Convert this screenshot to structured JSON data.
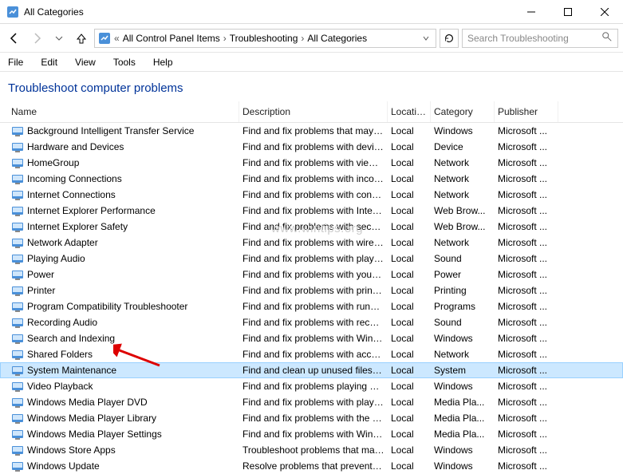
{
  "window": {
    "title": "All Categories"
  },
  "nav": {
    "breadcrumb": [
      "All Control Panel Items",
      "Troubleshooting",
      "All Categories"
    ],
    "search_placeholder": "Search Troubleshooting"
  },
  "menu": {
    "items": [
      "File",
      "Edit",
      "View",
      "Tools",
      "Help"
    ]
  },
  "heading": "Troubleshoot computer problems",
  "columns": {
    "name": "Name",
    "desc": "Description",
    "loc": "Location",
    "cat": "Category",
    "pub": "Publisher"
  },
  "rows": [
    {
      "name": "Background Intelligent Transfer Service",
      "desc": "Find and fix problems that may p...",
      "loc": "Local",
      "cat": "Windows",
      "pub": "Microsoft ..."
    },
    {
      "name": "Hardware and Devices",
      "desc": "Find and fix problems with device...",
      "loc": "Local",
      "cat": "Device",
      "pub": "Microsoft ..."
    },
    {
      "name": "HomeGroup",
      "desc": "Find and fix problems with viewin...",
      "loc": "Local",
      "cat": "Network",
      "pub": "Microsoft ..."
    },
    {
      "name": "Incoming Connections",
      "desc": "Find and fix problems with incom...",
      "loc": "Local",
      "cat": "Network",
      "pub": "Microsoft ..."
    },
    {
      "name": "Internet Connections",
      "desc": "Find and fix problems with conne...",
      "loc": "Local",
      "cat": "Network",
      "pub": "Microsoft ..."
    },
    {
      "name": "Internet Explorer Performance",
      "desc": "Find and fix problems with Intern...",
      "loc": "Local",
      "cat": "Web Brow...",
      "pub": "Microsoft ..."
    },
    {
      "name": "Internet Explorer Safety",
      "desc": "Find and fix problems with securi...",
      "loc": "Local",
      "cat": "Web Brow...",
      "pub": "Microsoft ..."
    },
    {
      "name": "Network Adapter",
      "desc": "Find and fix problems with wirele...",
      "loc": "Local",
      "cat": "Network",
      "pub": "Microsoft ..."
    },
    {
      "name": "Playing Audio",
      "desc": "Find and fix problems with playin...",
      "loc": "Local",
      "cat": "Sound",
      "pub": "Microsoft ..."
    },
    {
      "name": "Power",
      "desc": "Find and fix problems with your c...",
      "loc": "Local",
      "cat": "Power",
      "pub": "Microsoft ..."
    },
    {
      "name": "Printer",
      "desc": "Find and fix problems with printi...",
      "loc": "Local",
      "cat": "Printing",
      "pub": "Microsoft ..."
    },
    {
      "name": "Program Compatibility Troubleshooter",
      "desc": "Find and fix problems with runni...",
      "loc": "Local",
      "cat": "Programs",
      "pub": "Microsoft ..."
    },
    {
      "name": "Recording Audio",
      "desc": "Find and fix problems with record...",
      "loc": "Local",
      "cat": "Sound",
      "pub": "Microsoft ..."
    },
    {
      "name": "Search and Indexing",
      "desc": "Find and fix problems with Wind...",
      "loc": "Local",
      "cat": "Windows",
      "pub": "Microsoft ..."
    },
    {
      "name": "Shared Folders",
      "desc": "Find and fix problems with access...",
      "loc": "Local",
      "cat": "Network",
      "pub": "Microsoft ..."
    },
    {
      "name": "System Maintenance",
      "desc": "Find and clean up unused files an...",
      "loc": "Local",
      "cat": "System",
      "pub": "Microsoft ...",
      "selected": true
    },
    {
      "name": "Video Playback",
      "desc": "Find and fix problems playing mo...",
      "loc": "Local",
      "cat": "Windows",
      "pub": "Microsoft ..."
    },
    {
      "name": "Windows Media Player DVD",
      "desc": "Find and fix problems with playin...",
      "loc": "Local",
      "cat": "Media Pla...",
      "pub": "Microsoft ..."
    },
    {
      "name": "Windows Media Player Library",
      "desc": "Find and fix problems with the Wi...",
      "loc": "Local",
      "cat": "Media Pla...",
      "pub": "Microsoft ..."
    },
    {
      "name": "Windows Media Player Settings",
      "desc": "Find and fix problems with Wind...",
      "loc": "Local",
      "cat": "Media Pla...",
      "pub": "Microsoft ..."
    },
    {
      "name": "Windows Store Apps",
      "desc": "Troubleshoot problems that may ...",
      "loc": "Local",
      "cat": "Windows",
      "pub": "Microsoft ..."
    },
    {
      "name": "Windows Update",
      "desc": "Resolve problems that prevent yo...",
      "loc": "Local",
      "cat": "Windows",
      "pub": "Microsoft ..."
    }
  ],
  "watermark": "www.wintips.org"
}
